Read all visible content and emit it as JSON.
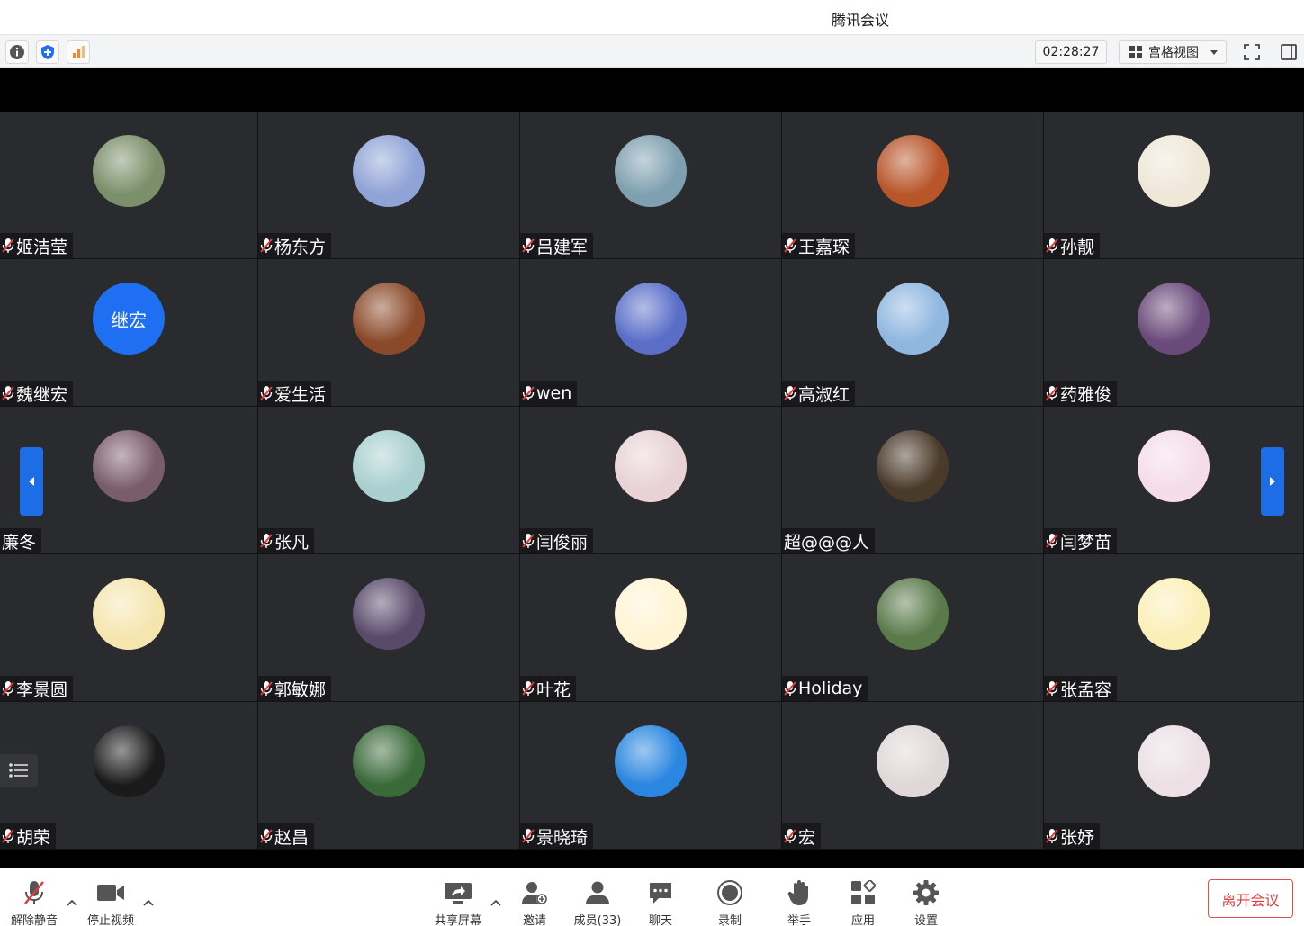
{
  "window": {
    "title": "腾讯会议"
  },
  "toolbar": {
    "info_icon": "info-icon",
    "security_icon": "shield-icon",
    "signal_icon": "signal-bars-icon",
    "timer": "02:28:27",
    "view_mode": "宫格视图",
    "fullscreen_icon": "fullscreen-icon",
    "sidepanel_icon": "sidebar-toggle-icon"
  },
  "participants": [
    {
      "name": "姬洁莹",
      "muted": true,
      "avatar": "photo-child",
      "color": "#7b8f6a"
    },
    {
      "name": "杨东方",
      "muted": true,
      "avatar": "photo-rabbit",
      "color": "#8fa3d6"
    },
    {
      "name": "吕建军",
      "muted": true,
      "avatar": "photo-lake",
      "color": "#7fa0b0"
    },
    {
      "name": "王嘉琛",
      "muted": true,
      "avatar": "photo-red-panda",
      "color": "#b8562a"
    },
    {
      "name": "孙靓",
      "muted": true,
      "avatar": "photo-tiger-painting",
      "color": "#efe7d8"
    },
    {
      "name": "魏继宏",
      "muted": true,
      "avatar_text": "继宏",
      "color": "#1e6ff1"
    },
    {
      "name": "爱生活",
      "muted": true,
      "avatar": "photo-autumn-street",
      "color": "#8a4a2a"
    },
    {
      "name": "wen",
      "muted": true,
      "avatar": "photo-sunset",
      "color": "#5a6ec8"
    },
    {
      "name": "高淑红",
      "muted": true,
      "avatar": "photo-red-flower",
      "color": "#8fb7e0"
    },
    {
      "name": "药雅俊",
      "muted": true,
      "avatar": "photo-woman-cat",
      "color": "#6a4a7a"
    },
    {
      "name": "廉冬",
      "muted": false,
      "avatar": "photo-anime-girl",
      "color": "#7a5d6a"
    },
    {
      "name": "张凡",
      "muted": true,
      "avatar": "photo-cartoon-umbrella",
      "color": "#a9cfcf"
    },
    {
      "name": "闫俊丽",
      "muted": true,
      "avatar": "photo-flower-girl",
      "color": "#e8d2d6"
    },
    {
      "name": "超@@@人",
      "muted": false,
      "avatar": "photo-dark-sphere",
      "color": "#4a3a2a"
    },
    {
      "name": "闫梦苗",
      "muted": true,
      "avatar": "photo-pink-doodle",
      "color": "#f5dde8"
    },
    {
      "name": "李景圆",
      "muted": true,
      "avatar": "photo-cartoon-cat",
      "color": "#f5e6b0"
    },
    {
      "name": "郭敏娜",
      "muted": true,
      "avatar": "photo-bunny-girl",
      "color": "#5a4a6a"
    },
    {
      "name": "叶花",
      "muted": true,
      "avatar": "photo-pompompurin",
      "color": "#fff4d4"
    },
    {
      "name": "Holiday",
      "muted": true,
      "avatar": "photo-holiday-figure",
      "color": "#5a7a4a"
    },
    {
      "name": "张孟容",
      "muted": true,
      "avatar": "photo-white-bear",
      "color": "#fbefb8"
    },
    {
      "name": "胡荣",
      "muted": true,
      "avatar": "photo-tunnel",
      "color": "#1a1a1a"
    },
    {
      "name": "赵昌",
      "muted": true,
      "avatar": "photo-lotus",
      "color": "#3a6a3a"
    },
    {
      "name": "景晓琦",
      "muted": true,
      "avatar": "photo-sunflower-sky",
      "color": "#2a86e0"
    },
    {
      "name": "宏",
      "muted": true,
      "avatar": "photo-cartoon-face",
      "color": "#e0d8d8"
    },
    {
      "name": "张妤",
      "muted": true,
      "avatar": "photo-cherry-blossom",
      "color": "#ece0e4"
    }
  ],
  "bottombar": {
    "unmute": "解除静音",
    "stop_video": "停止视频",
    "share_screen": "共享屏幕",
    "invite": "邀请",
    "members": "成员(33)",
    "chat": "聊天",
    "record": "录制",
    "raise_hand": "举手",
    "apps": "应用",
    "settings": "设置",
    "leave": "离开会议"
  }
}
